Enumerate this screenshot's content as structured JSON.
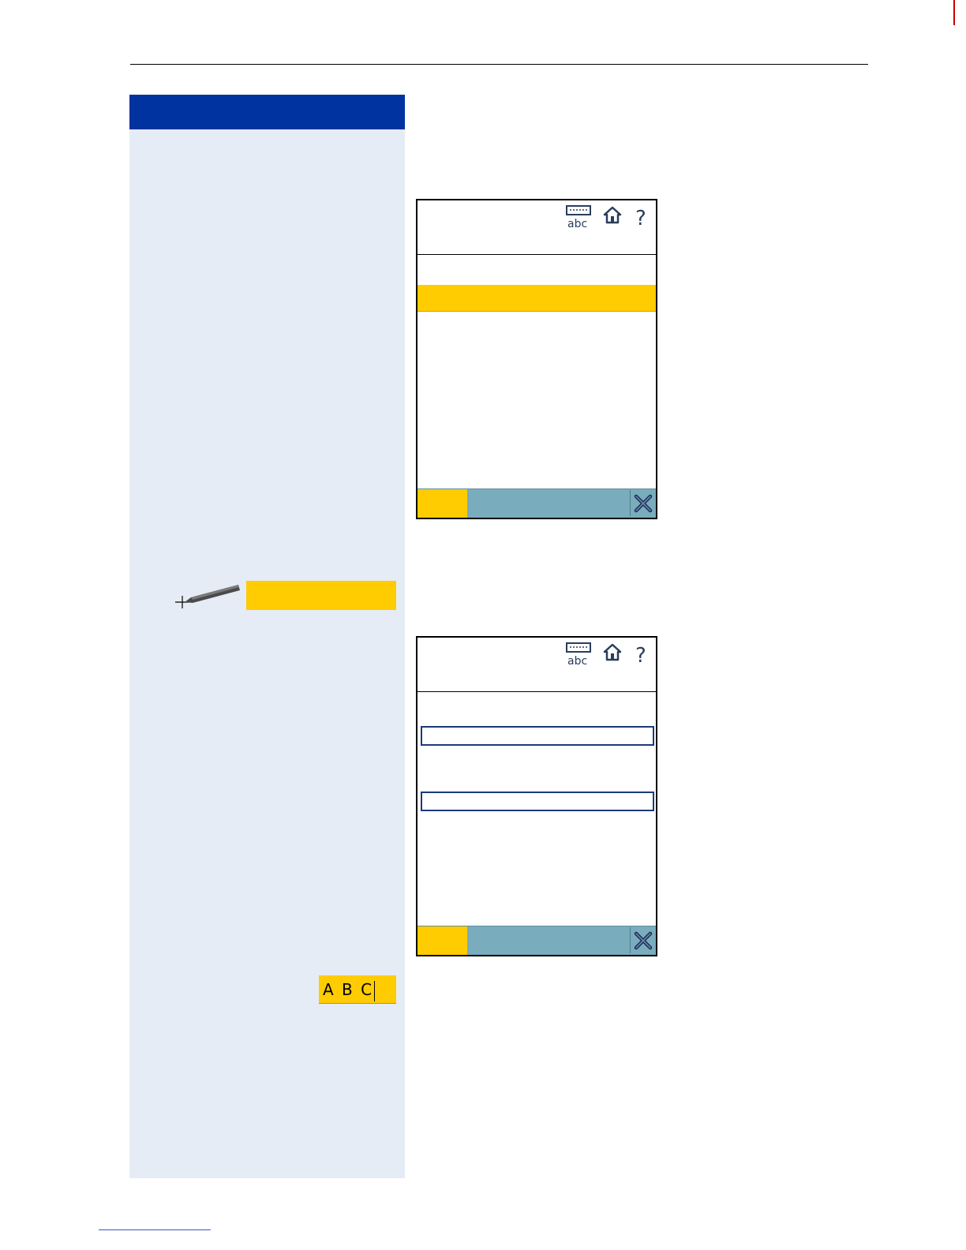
{
  "screens": [
    {
      "status_icons": [
        "keyboard-abc-icon",
        "home-icon",
        "help-icon"
      ],
      "selected_row": "",
      "softkeys": {
        "ok_label": "",
        "close_icon": "close-x-icon"
      }
    },
    {
      "status_icons": [
        "keyboard-abc-icon",
        "home-icon",
        "help-icon"
      ],
      "input_fields": [
        "",
        ""
      ],
      "softkeys": {
        "ok_label": "",
        "close_icon": "close-x-icon"
      }
    }
  ],
  "stylus_step": {
    "icon": "stylus-icon",
    "label": ""
  },
  "text_entry_example": {
    "text": "A B C"
  },
  "colors": {
    "sidebar_header": "#0033a0",
    "sidebar_bg": "#e6ecf5",
    "highlight": "#fecc00",
    "softkey_bar": "#79acbc",
    "page_mark": "#cc0000"
  }
}
